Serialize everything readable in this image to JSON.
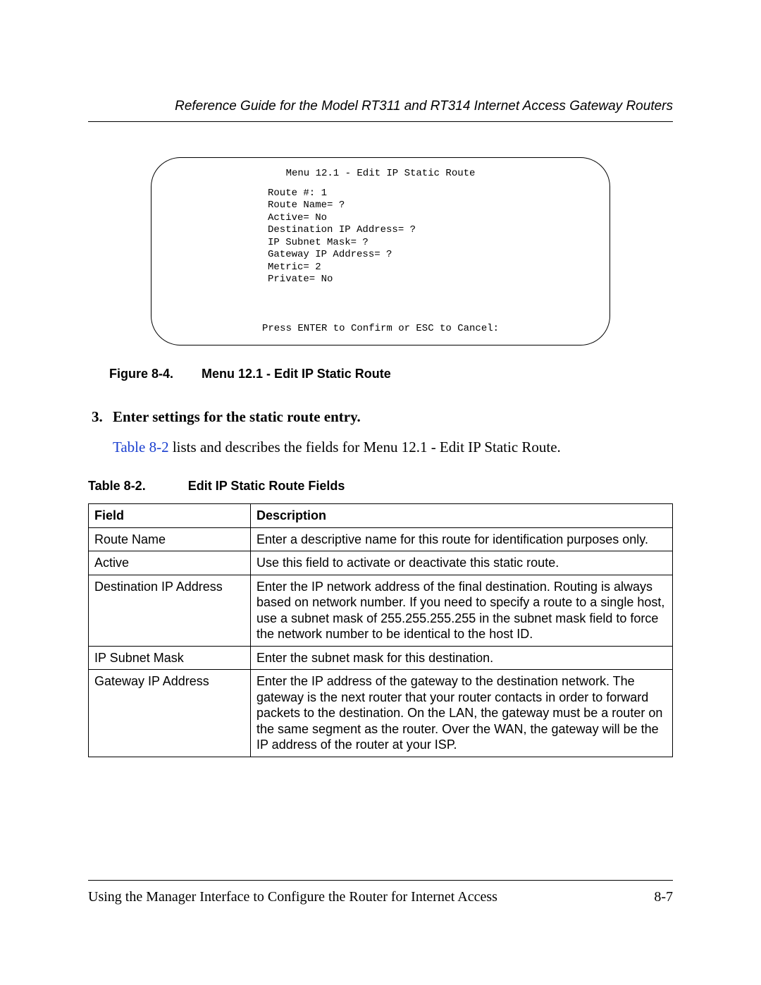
{
  "header": {
    "title": "Reference Guide for the Model RT311 and RT314 Internet Access Gateway Routers"
  },
  "terminal": {
    "title": "Menu 12.1 - Edit IP Static Route",
    "lines": [
      "Route #: 1",
      "Route Name= ?",
      "Active= No",
      "Destination IP Address= ?",
      "IP Subnet Mask= ?",
      "Gateway IP Address= ?",
      "Metric= 2",
      "Private= No"
    ],
    "footer": "Press ENTER to Confirm or ESC to Cancel:"
  },
  "figure": {
    "label": "Figure 8-4.",
    "title": "Menu 12.1 - Edit IP Static Route"
  },
  "step": {
    "num": "3.",
    "text": "Enter settings for the static route entry.",
    "ref": "Table 8-2",
    "desc_rest": " lists and describes the fields for Menu 12.1 - Edit IP Static Route."
  },
  "table": {
    "label": "Table 8-2.",
    "title": "Edit IP Static Route Fields",
    "headers": {
      "field": "Field",
      "desc": "Description"
    },
    "rows": [
      {
        "field": "Route Name",
        "desc": "Enter a descriptive name for this route for identification purposes only."
      },
      {
        "field": "Active",
        "desc": "Use this field to activate or deactivate this static route."
      },
      {
        "field": "Destination IP Address",
        "desc": "Enter the IP network address of the final destination. Routing is always based on network number. If you need to specify a route to a single host, use a subnet mask of 255.255.255.255 in the subnet mask field to force the network number to be identical to the host ID."
      },
      {
        "field": "IP Subnet Mask",
        "desc": "Enter the subnet mask for this destination."
      },
      {
        "field": "Gateway IP Address",
        "desc": "Enter the IP address of the gateway to the destination network. The gateway is the next router that your router contacts in order to forward packets to the destination. On the LAN, the gateway must be a router on the same segment as the router. Over the WAN, the gateway will be the IP address of the router at your ISP."
      }
    ]
  },
  "footer": {
    "text": "Using the Manager Interface to Configure the Router for Internet Access",
    "page": "8-7"
  }
}
